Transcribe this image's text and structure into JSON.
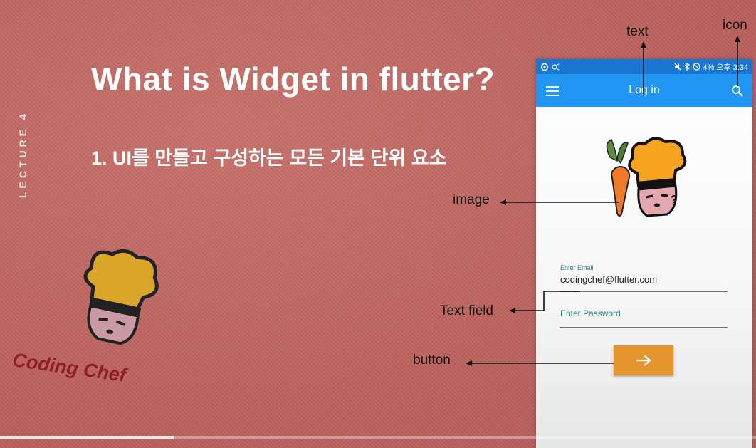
{
  "slide": {
    "title": "What is Widget in flutter?",
    "point": "1.  UI를 만들고 구성하는 모든 기본 단위 요소",
    "lecture_label": "LECTURE 4",
    "logo_text": "Coding Chef"
  },
  "phone": {
    "status": {
      "right_text": "4% 오후 3:34"
    },
    "app_bar": {
      "title": "Log in",
      "leading_icon": "menu-icon",
      "action_icon": "search-icon",
      "color": "#2196f3"
    },
    "image_overlay_char": "?",
    "email_field": {
      "label": "Enter Email",
      "value": "codingchef@flutter.com"
    },
    "password_field": {
      "placeholder": "Enter Password"
    },
    "button": {
      "icon": "arrow-right-icon",
      "color": "#e5942e"
    }
  },
  "annotations": {
    "text": "text",
    "icon": "icon",
    "image": "image",
    "text_field": "Text field",
    "button": "button"
  },
  "video_progress": 0.23
}
